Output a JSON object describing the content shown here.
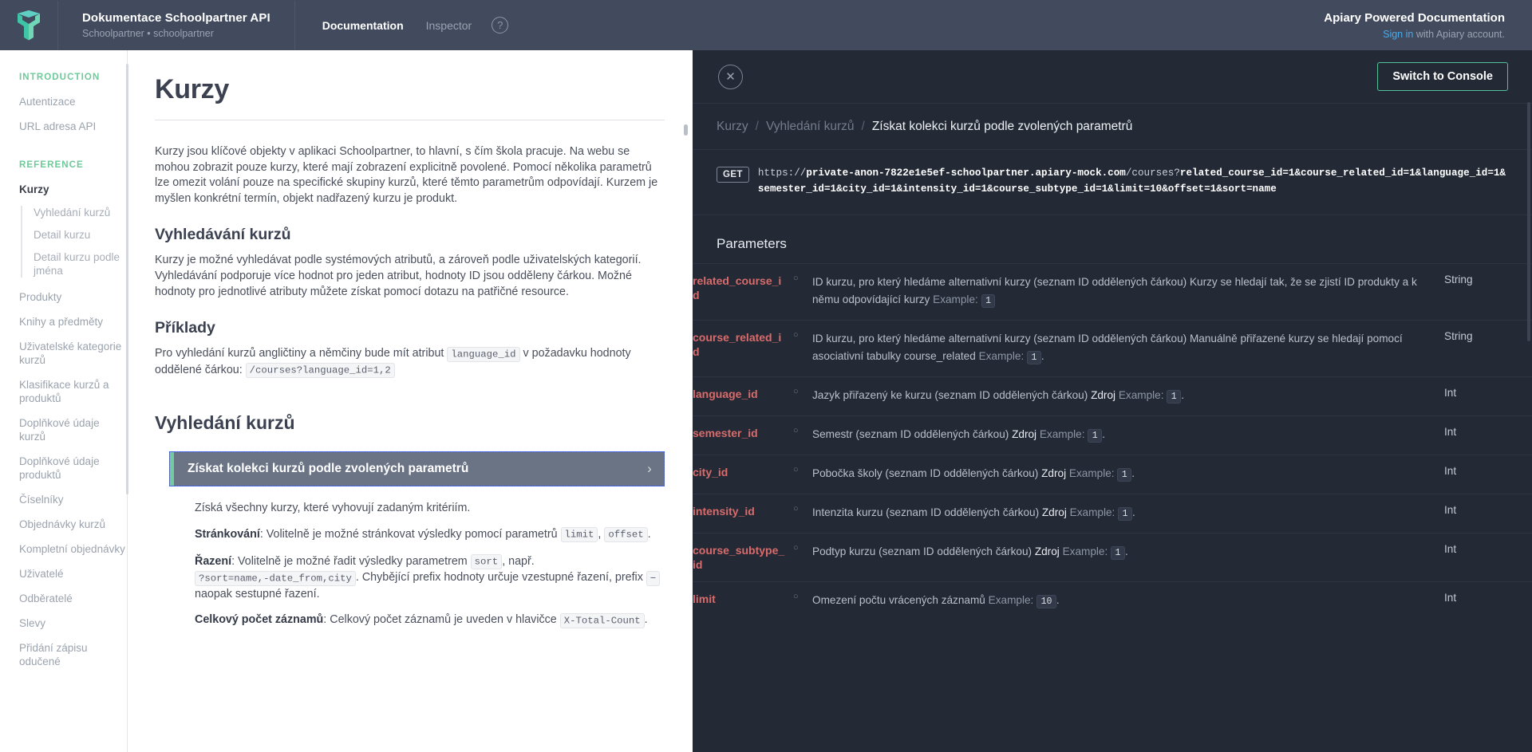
{
  "header": {
    "logo_name": "apiary-logo",
    "doc_title": "Dokumentace Schoolpartner API",
    "doc_subtitle": "Schoolpartner • schoolpartner",
    "tabs": [
      {
        "label": "Documentation",
        "active": true
      },
      {
        "label": "Inspector",
        "active": false
      }
    ],
    "help_glyph": "?",
    "right_title": "Apiary Powered Documentation",
    "signin_link": "Sign in",
    "signin_rest": " with Apiary account."
  },
  "sidebar": {
    "section_intro": "INTRODUCTION",
    "intro_items": [
      {
        "label": "Autentizace"
      },
      {
        "label": "URL adresa API"
      }
    ],
    "section_reference": "REFERENCE",
    "current": "Kurzy",
    "sub_items": [
      {
        "label": "Vyhledání kurzů"
      },
      {
        "label": "Detail kurzu"
      },
      {
        "label": "Detail kurzu podle jména"
      }
    ],
    "items": [
      {
        "label": "Produkty"
      },
      {
        "label": "Knihy a předměty"
      },
      {
        "label": "Uživatelské kategorie kurzů"
      },
      {
        "label": "Klasifikace kurzů a produktů"
      },
      {
        "label": "Doplňkové údaje kurzů"
      },
      {
        "label": "Doplňkové údaje produktů"
      },
      {
        "label": "Číselníky"
      },
      {
        "label": "Objednávky kurzů"
      },
      {
        "label": "Kompletní objednávky"
      },
      {
        "label": "Uživatelé"
      },
      {
        "label": "Odběratelé"
      },
      {
        "label": "Slevy"
      },
      {
        "label": "Přidání zápisu odučené"
      }
    ]
  },
  "doc": {
    "page_title": "Kurzy",
    "intro_paragraph": "Kurzy jsou klíčové objekty v aplikaci Schoolpartner, to hlavní, s čím škola pracuje. Na webu se mohou zobrazit pouze kurzy, které mají zobrazení explicitně povolené. Pomocí několika parametrů lze omezit volání pouze na specifické skupiny kurzů, které těmto parametrům odpovídají. Kurzem je myšlen konkrétní termín, objekt nadřazený kurzu je produkt.",
    "h_search": "Vyhledávání kurzů",
    "search_paragraph": "Kurzy je možné vyhledávat podle systémových atributů, a zároveň podle uživatelských kategorií. Vyhledávání podporuje více hodnot pro jeden atribut, hodnoty ID jsou odděleny čárkou. Možné hodnoty pro jednotlivé atributy můžete získat pomocí dotazu na patřičné resource.",
    "h_examples": "Příklady",
    "example_pre": "Pro vyhledání kurzů angličtiny a němčiny bude mít atribut ",
    "example_code1": "language_id",
    "example_mid": " v požadavku hodnoty oddělené čárkou: ",
    "example_code2": "/courses?language_id=1,2",
    "h_find": "Vyhledání kurzů",
    "action_label": "Získat kolekci kurzů podle zvolených parametrů",
    "action_chevron": "›",
    "desc_line1": "Získá všechny kurzy, které vyhovují zadaným kritériím.",
    "pag_label": "Stránkování",
    "pag_text1": ": Volitelně je možné stránkovat výsledky pomocí parametrů ",
    "pag_code1": "limit",
    "pag_comma": ", ",
    "pag_code2": "offset",
    "pag_end": ".",
    "sort_label": "Řazení",
    "sort_text1": ": Volitelně je možné řadit výsledky parametrem ",
    "sort_code1": "sort",
    "sort_text2": ", např. ",
    "sort_code2": "?sort=name,-date_from,city",
    "sort_text3": ". Chybějící prefix hodnoty určuje vzestupné řazení, prefix ",
    "sort_code3": "−",
    "sort_text4": " naopak sestupné řazení.",
    "total_label": "Celkový počet záznamů",
    "total_text": ": Celkový počet záznamů je uveden v hlavičce ",
    "total_code": "X-Total-Count",
    "total_end": "."
  },
  "console": {
    "close_glyph": "✕",
    "switch_button": "Switch to Console",
    "breadcrumb": [
      {
        "label": "Kurzy",
        "current": false
      },
      {
        "label": "Vyhledání kurzů",
        "current": false
      },
      {
        "label": "Získat kolekci kurzů podle zvolených parametrů",
        "current": true
      }
    ],
    "breadcrumb_separator": "/",
    "method": "GET",
    "url_scheme": "https://",
    "url_host": "private-anon-7822e1e5ef-schoolpartner.apiary-mock.com",
    "url_path": "/courses?",
    "url_query": "related_course_id=1&course_related_id=1&language_id=1&semester_id=1&city_id=1&intensity_id=1&course_subtype_id=1&limit=10&offset=1&sort=name",
    "params_title": "Parameters",
    "optional_marker": "○",
    "example_label": "Example:",
    "parameters": [
      {
        "name": "related_course_id",
        "desc": "ID kurzu, pro který hledáme alternativní kurzy (seznam ID oddělených čárkou) Kurzy se hledají tak, že se zjistí ID produkty a k němu odpovídající kurzy",
        "link": "",
        "example": "1",
        "example_suffix": "",
        "type": "String"
      },
      {
        "name": "course_related_id",
        "desc": "ID kurzu, pro který hledáme alternativní kurzy (seznam ID oddělených čárkou) Manuálně přiřazené kurzy se hledají pomocí asociativní tabulky course_related",
        "link": "",
        "example": "1",
        "example_suffix": ".",
        "type": "String"
      },
      {
        "name": "language_id",
        "desc": "Jazyk přiřazený ke kurzu (seznam ID oddělených čárkou) ",
        "link": "Zdroj",
        "example": "1",
        "example_suffix": ".",
        "type": "Int"
      },
      {
        "name": "semester_id",
        "desc": "Semestr (seznam ID oddělených čárkou) ",
        "link": "Zdroj",
        "example": "1",
        "example_suffix": ".",
        "type": "Int"
      },
      {
        "name": "city_id",
        "desc": "Pobočka školy (seznam ID oddělených čárkou) ",
        "link": "Zdroj",
        "example": "1",
        "example_suffix": ".",
        "type": "Int"
      },
      {
        "name": "intensity_id",
        "desc": "Intenzita kurzu (seznam ID oddělených čárkou) ",
        "link": "Zdroj",
        "example": "1",
        "example_suffix": ".",
        "type": "Int"
      },
      {
        "name": "course_subtype_id",
        "desc": "Podtyp kurzu (seznam ID oddělených čárkou) ",
        "link": "Zdroj",
        "example": "1",
        "example_suffix": ".",
        "type": "Int"
      },
      {
        "name": "limit",
        "desc": "Omezení počtu vrácených záznamů ",
        "link": "",
        "example": "10",
        "example_suffix": ".",
        "type": "Int"
      }
    ]
  },
  "colors": {
    "header_bg": "#424b5e",
    "console_bg": "#232935",
    "accent_green": "#6fc99a",
    "param_red": "#d96b6b",
    "link_blue": "#4aa9e8"
  }
}
